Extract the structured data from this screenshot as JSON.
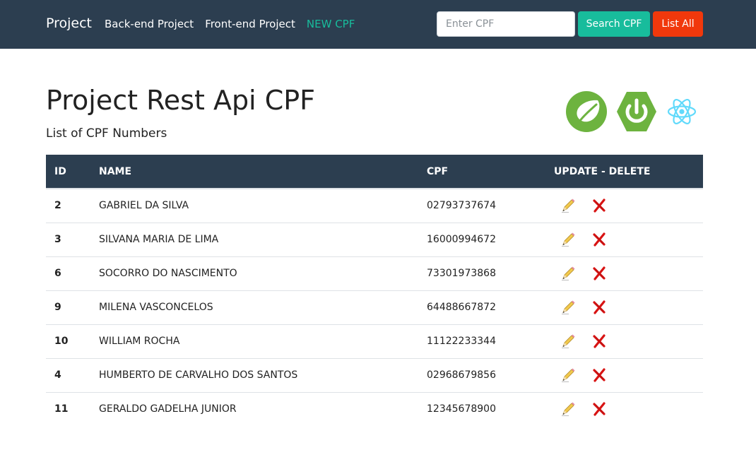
{
  "navbar": {
    "brand": "Project",
    "links": [
      {
        "label": "Back-end Project"
      },
      {
        "label": "Front-end Project"
      },
      {
        "label": "NEW CPF"
      }
    ],
    "search": {
      "placeholder": "Enter CPF",
      "value": ""
    },
    "search_button": "Search CPF",
    "list_all_button": "List All",
    "colors": {
      "background": "#2c3e50",
      "active_link": "#18bc9c",
      "search_button": "#18bc9c",
      "list_button": "#f1380c"
    }
  },
  "header": {
    "title": "Project Rest Api CPF",
    "subtitle": "List of CPF Numbers",
    "logos": [
      "spring-leaf-icon",
      "spring-boot-power-icon",
      "react-atom-icon"
    ]
  },
  "table": {
    "columns": [
      "ID",
      "NAME",
      "CPF",
      "UPDATE - DELETE"
    ],
    "rows": [
      {
        "id": "2",
        "name": "GABRIEL DA SILVA",
        "cpf": "02793737674"
      },
      {
        "id": "3",
        "name": "SILVANA MARIA DE LIMA",
        "cpf": "16000994672"
      },
      {
        "id": "6",
        "name": "SOCORRO DO NASCIMENTO",
        "cpf": "73301973868"
      },
      {
        "id": "9",
        "name": "MILENA VASCONCELOS",
        "cpf": "64488667872"
      },
      {
        "id": "10",
        "name": "WILLIAM ROCHA",
        "cpf": "11122233344"
      },
      {
        "id": "4",
        "name": "HUMBERTO DE CARVALHO DOS SANTOS",
        "cpf": "02968679856"
      },
      {
        "id": "11",
        "name": "GERALDO GADELHA JUNIOR",
        "cpf": "12345678900"
      }
    ],
    "row_actions": {
      "update_icon": "pencil-icon",
      "delete_icon": "red-x-icon"
    }
  }
}
